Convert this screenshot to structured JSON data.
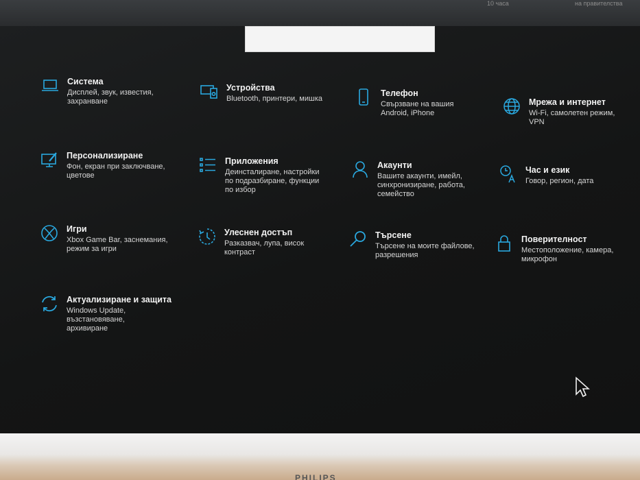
{
  "top": {
    "text_a": "10 часа",
    "text_b": "на правителства"
  },
  "search": {
    "placeholder": ""
  },
  "tiles": [
    {
      "title": "Система",
      "desc": "Дисплей, звук, известия,\nзахранване"
    },
    {
      "title": "Устройства",
      "desc": "Bluetooth, принтери, мишка"
    },
    {
      "title": "Телефон",
      "desc": "Свързване на вашия\nAndroid, iPhone"
    },
    {
      "title": "Мрежа и интернет",
      "desc": "Wi-Fi, самолетен режим,\nVPN"
    },
    {
      "title": "Персонализиране",
      "desc": "Фон, екран при заключване,\nцветове"
    },
    {
      "title": "Приложения",
      "desc": "Деинсталиране, настройки\nпо подразбиране, функции\nпо избор"
    },
    {
      "title": "Акаунти",
      "desc": "Вашите акаунти, имейл,\nсинхронизиране, работа,\nсемейство"
    },
    {
      "title": "Час и език",
      "desc": "Говор, регион, дата"
    },
    {
      "title": "Игри",
      "desc": "Xbox Game Bar, заснемания,\nрежим за игри"
    },
    {
      "title": "Улеснен достъп",
      "desc": "Разказвач, лупа, висок\nконтраст"
    },
    {
      "title": "Търсене",
      "desc": "Търсене на моите файлове,\nразрешения"
    },
    {
      "title": "Поверителност",
      "desc": "Местоположение, камера,\nмикрофон"
    },
    {
      "title": "Актуализиране и защита",
      "desc": "Windows Update,\nвъзстановяване,\nархивиране"
    }
  ],
  "icons": {
    "accent": "#2aa9e0",
    "names": [
      "laptop-icon",
      "devices-icon",
      "phone-icon",
      "globe-icon",
      "personalization-icon",
      "apps-icon",
      "account-icon",
      "time-language-icon",
      "xbox-icon",
      "ease-of-access-icon",
      "search-icon",
      "lock-icon",
      "update-icon"
    ]
  },
  "bezel": {
    "brand": "PHILIPS"
  }
}
